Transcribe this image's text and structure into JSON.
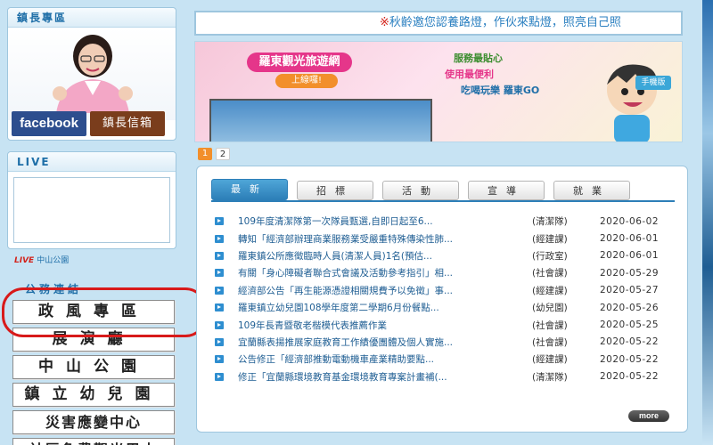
{
  "mayor": {
    "title": "鎮長專區",
    "facebook_label": "facebook",
    "mailbox_label": "鎮長信箱"
  },
  "live": {
    "title": "LIVE",
    "badge": "LIVE",
    "caption": "中山公園"
  },
  "quick_links": {
    "title": "公務連結",
    "items": [
      "政風專區",
      "展演廳",
      "中山公園",
      "鎮立幼兒園",
      "災害應變中心",
      "社區免費觀光巴士"
    ]
  },
  "marquee": {
    "mark": "※",
    "text": "秋齡邀您認養路燈，作伙來點燈，照亮自己照"
  },
  "banner": {
    "title": "羅東觀光旅遊網",
    "subtitle": "上線囉!",
    "slogan1": "服務最貼心",
    "slogan2": "使用最便利",
    "slogan3": "吃喝玩樂 羅東GO",
    "mobile_tag": "手機版"
  },
  "pager": [
    "1",
    "2"
  ],
  "news": {
    "tabs": [
      "最新",
      "招標",
      "活動",
      "宣導",
      "就業"
    ],
    "active_tab": 0,
    "rows": [
      {
        "title": "109年度清潔隊第一次隊員甄選,自即日起至6...",
        "dept": "(清潔隊)",
        "date": "2020-06-02"
      },
      {
        "title": "轉知「經濟部辦理商業服務業受嚴重特殊傳染性肺...",
        "dept": "(經建課)",
        "date": "2020-06-01"
      },
      {
        "title": "羅東鎮公所應徵臨時人員(清潔人員)1名(預估...",
        "dept": "(行政室)",
        "date": "2020-06-01"
      },
      {
        "title": "有關「身心障礙者聯合式會議及活動參考指引」相...",
        "dept": "(社會課)",
        "date": "2020-05-29"
      },
      {
        "title": "經濟部公告「再生能源憑證相關規費予以免徵」事...",
        "dept": "(經建課)",
        "date": "2020-05-27"
      },
      {
        "title": "羅東鎮立幼兒園108學年度第二學期6月份餐點...",
        "dept": "(幼兒園)",
        "date": "2020-05-26"
      },
      {
        "title": "109年長青暨敬老楷模代表推薦作業",
        "dept": "(社會課)",
        "date": "2020-05-25"
      },
      {
        "title": "宜蘭縣表揚推展家庭教育工作績優團體及個人實施...",
        "dept": "(社會課)",
        "date": "2020-05-22"
      },
      {
        "title": "公告修正「經濟部推動電動機車產業精助要點...",
        "dept": "(經建課)",
        "date": "2020-05-22"
      },
      {
        "title": "修正「宜蘭縣環境教育基金環境教育專案計畫補(...",
        "dept": "(清潔隊)",
        "date": "2020-05-22"
      }
    ],
    "more_label": "more"
  },
  "colors": {
    "accent": "#2d7fb8",
    "highlight": "#d81a1a",
    "facebook": "#2d4e8e"
  }
}
